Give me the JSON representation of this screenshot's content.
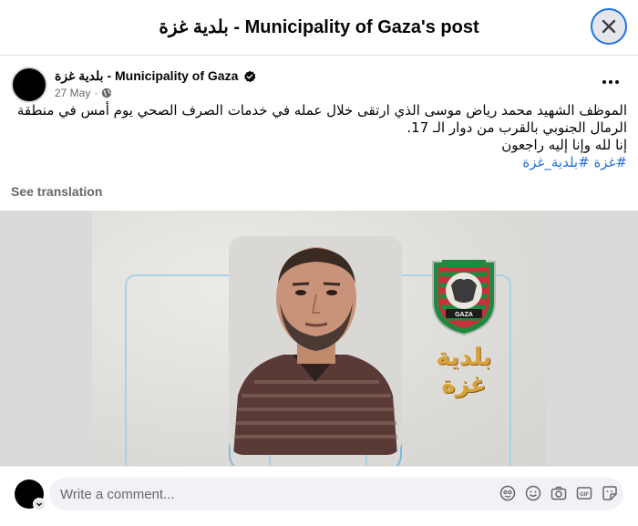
{
  "dialog": {
    "title": "بلدية غزة - Municipality of Gaza's post"
  },
  "post": {
    "author": "بلدية غزة - Municipality of Gaza",
    "date": "27 May",
    "meta_separator": "·",
    "body_lines": [
      "الموظف الشهيد محمد رياض موسى الذي ارتقى  خلال عمله في خدمات الصرف الصحي يوم أمس في منطقة",
      "الرمال الجنوبي بالقرب من دوار الـ 17.",
      "إنا لله وإنا إليه راجعون"
    ],
    "hashtags": "#غزة #بلدية_غزة",
    "see_translation": "See translation"
  },
  "media": {
    "emblem_caption": "بلدية غزة",
    "emblem_badge": "GAZA"
  },
  "comment": {
    "placeholder": "Write a comment..."
  },
  "colors": {
    "accent_blue": "#1b74e4",
    "hashtag_blue": "#216fdb",
    "muted_text": "#65676b"
  },
  "icons": {
    "close": "close-icon",
    "verified": "verified-badge-icon",
    "privacy": "globe-icon",
    "more": "more-options-icon",
    "comment_tools": [
      "avatar-sticker-icon",
      "emoji-icon",
      "camera-icon",
      "gif-icon",
      "sticker-icon"
    ]
  }
}
